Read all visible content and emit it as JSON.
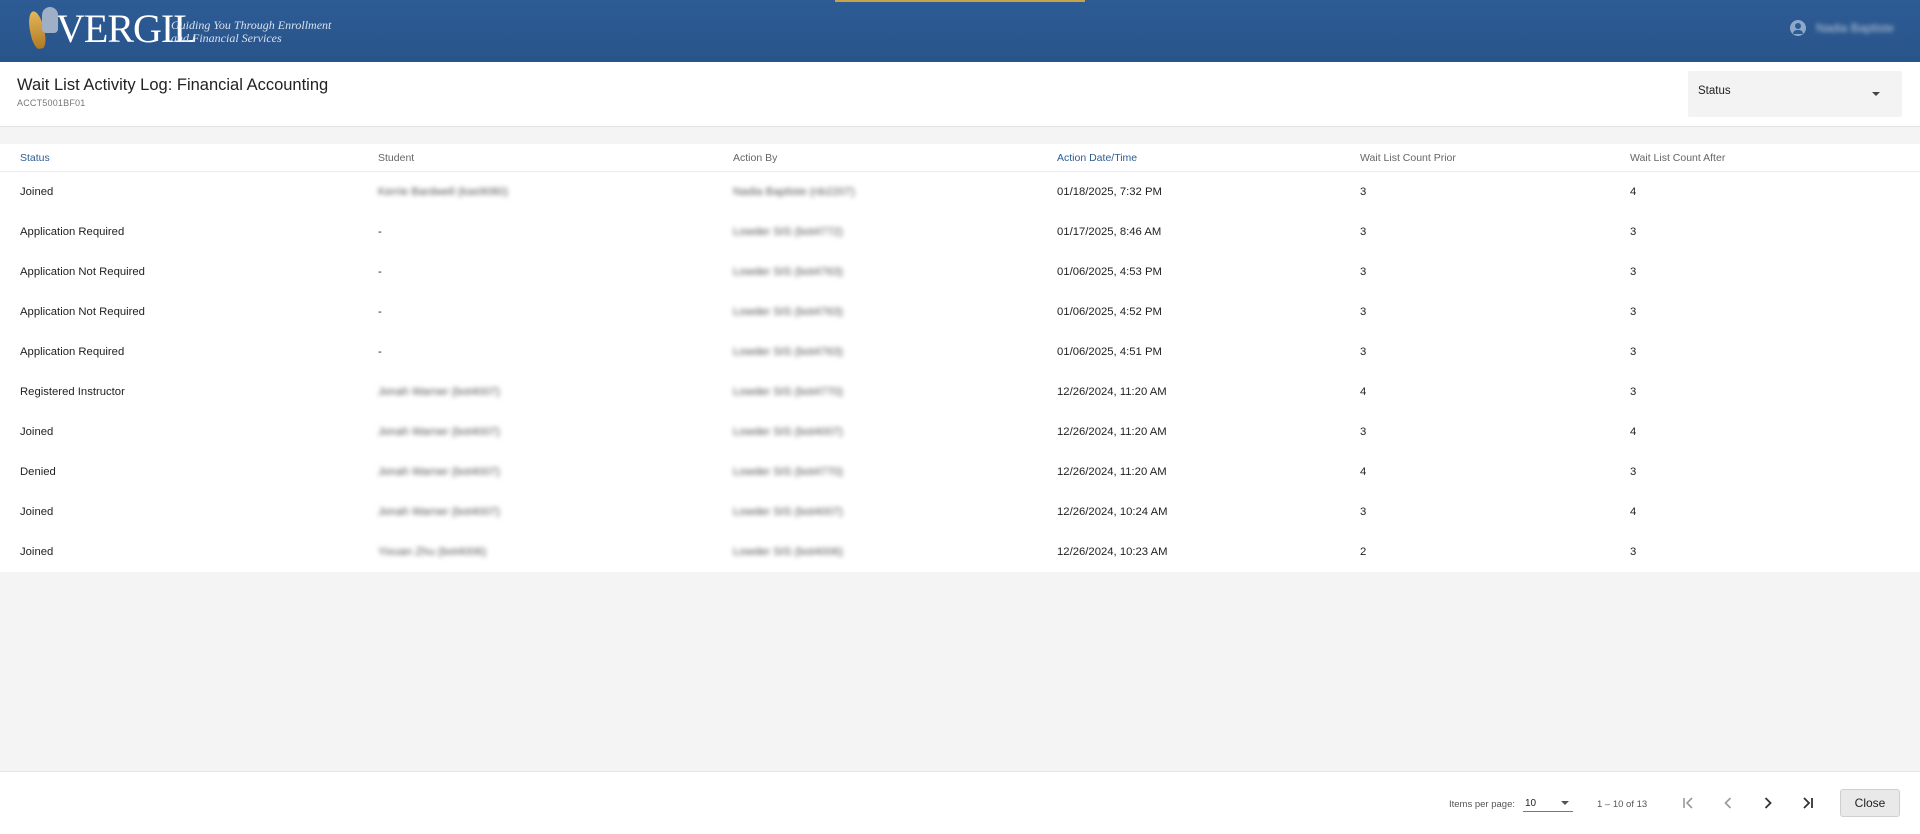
{
  "header": {
    "logo_text": "VERGIL",
    "tagline_line1": "Guiding You Through Enrollment",
    "tagline_line2": "and Financial Services",
    "user_name": "Nadia Baptiste"
  },
  "page": {
    "title": "Wait List Activity Log: Financial Accounting",
    "subtitle": "ACCT5001BF01",
    "status_filter_label": "Status"
  },
  "table": {
    "columns": [
      "Status",
      "Student",
      "Action By",
      "Action Date/Time",
      "Wait List Count Prior",
      "Wait List Count After"
    ],
    "rows": [
      {
        "status": "Joined",
        "student": "Kerrie Bardwell (kas9080)",
        "action_by": "Nadia Baptiste (nb2207)",
        "datetime": "01/18/2025, 7:32 PM",
        "prior": "3",
        "after": "4"
      },
      {
        "status": "Application Required",
        "student": "-",
        "action_by": "Lowder SIS (bot4772)",
        "datetime": "01/17/2025, 8:46 AM",
        "prior": "3",
        "after": "3"
      },
      {
        "status": "Application Not Required",
        "student": "-",
        "action_by": "Lowder SIS (bot4763)",
        "datetime": "01/06/2025, 4:53 PM",
        "prior": "3",
        "after": "3"
      },
      {
        "status": "Application Not Required",
        "student": "-",
        "action_by": "Lowder SIS (bot4763)",
        "datetime": "01/06/2025, 4:52 PM",
        "prior": "3",
        "after": "3"
      },
      {
        "status": "Application Required",
        "student": "-",
        "action_by": "Lowder SIS (bot4763)",
        "datetime": "01/06/2025, 4:51 PM",
        "prior": "3",
        "after": "3"
      },
      {
        "status": "Registered Instructor",
        "student": "Jonah Warner (bot4007)",
        "action_by": "Lowder SIS (bot4770)",
        "datetime": "12/26/2024, 11:20 AM",
        "prior": "4",
        "after": "3"
      },
      {
        "status": "Joined",
        "student": "Jonah Warner (bot4007)",
        "action_by": "Lowder SIS (bot4007)",
        "datetime": "12/26/2024, 11:20 AM",
        "prior": "3",
        "after": "4"
      },
      {
        "status": "Denied",
        "student": "Jonah Warner (bot4007)",
        "action_by": "Lowder SIS (bot4770)",
        "datetime": "12/26/2024, 11:20 AM",
        "prior": "4",
        "after": "3"
      },
      {
        "status": "Joined",
        "student": "Jonah Warner (bot4007)",
        "action_by": "Lowder SIS (bot4007)",
        "datetime": "12/26/2024, 10:24 AM",
        "prior": "3",
        "after": "4"
      },
      {
        "status": "Joined",
        "student": "Yixuan Zhu (bot4006)",
        "action_by": "Lowder SIS (bot4006)",
        "datetime": "12/26/2024, 10:23 AM",
        "prior": "2",
        "after": "3"
      }
    ]
  },
  "footer": {
    "items_per_page_label": "Items per page:",
    "items_per_page_value": "10",
    "range_text": "1 – 10 of 13",
    "close_label": "Close"
  },
  "colors": {
    "header_bg": "#2d5b94",
    "sorted_header": "#2d5b94"
  },
  "icons": {
    "first_page": "first-page-icon",
    "prev_page": "chevron-left-icon",
    "next_page": "chevron-right-icon",
    "last_page": "last-page-icon",
    "user": "account-circle-icon"
  }
}
